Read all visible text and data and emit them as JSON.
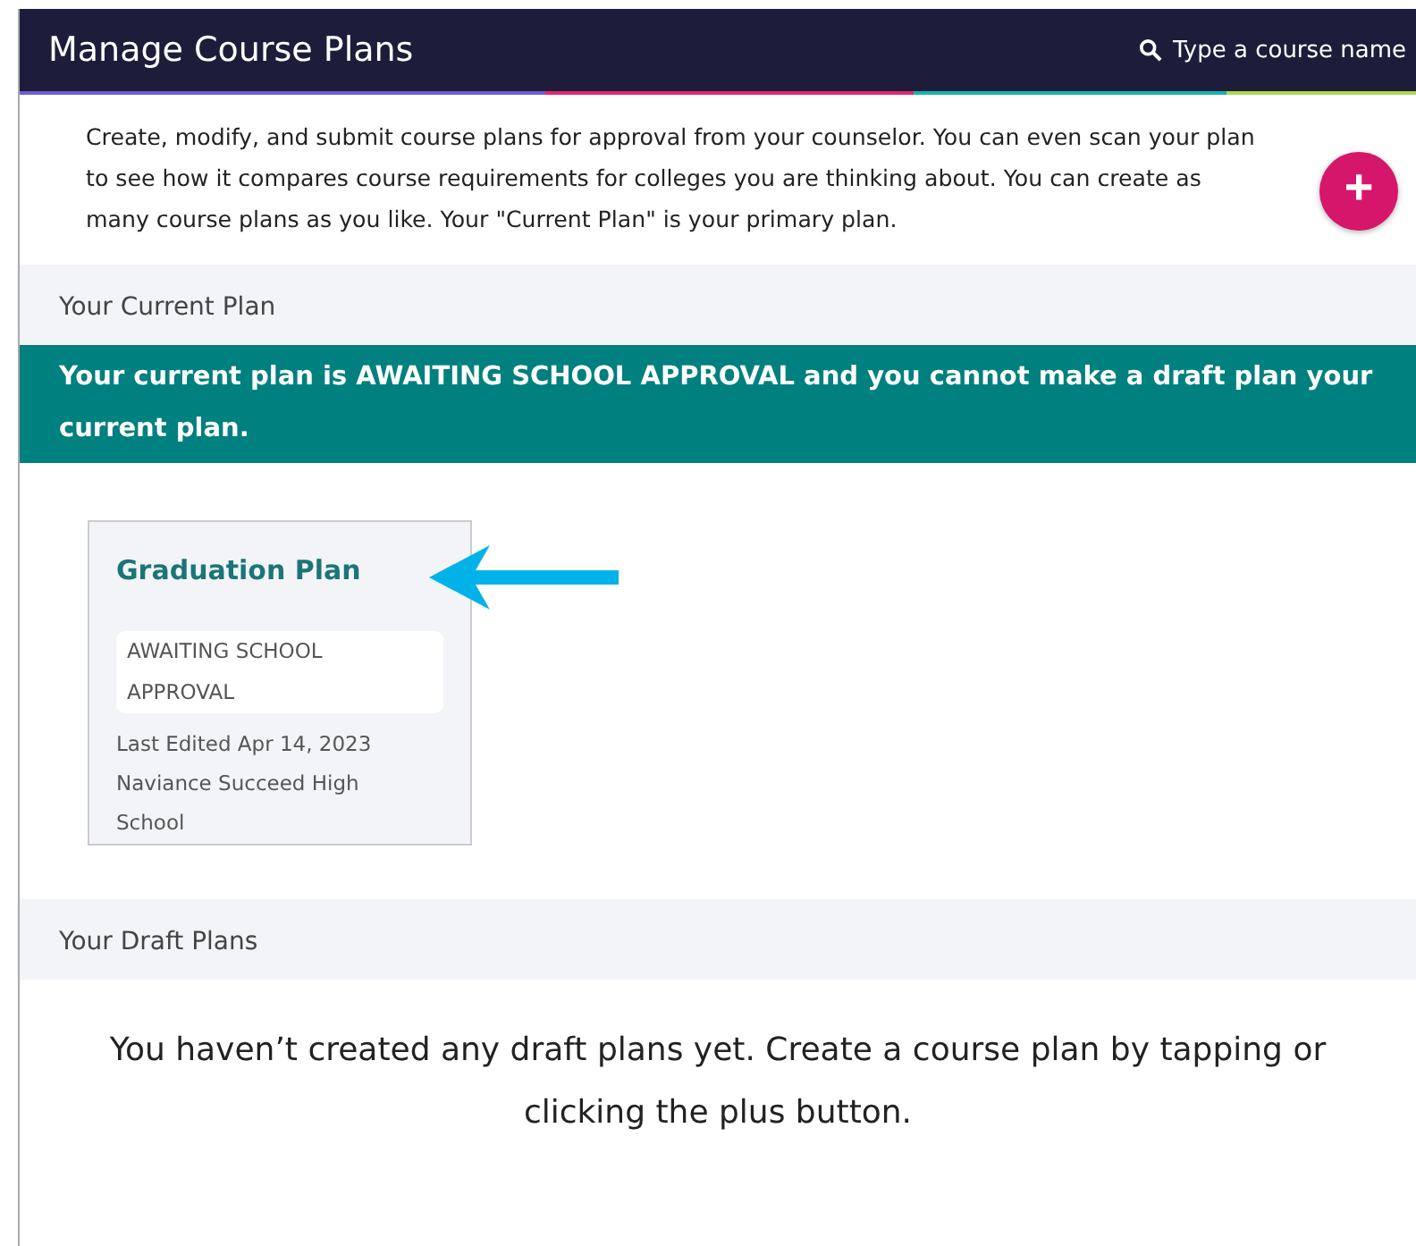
{
  "header": {
    "title": "Manage Course Plans",
    "search": {
      "placeholder": "Type a course name"
    }
  },
  "intro": "Create, modify, and submit course plans for approval from your counselor. You can even scan your plan to see how it compares course requirements for colleges you are thinking about. You can create as many course plans as you like. Your \"Current Plan\" is your primary plan.",
  "add_button": "+",
  "current_section": {
    "heading": "Your Current Plan",
    "banner": "Your current plan is AWAITING SCHOOL APPROVAL and you cannot make a draft plan your current plan.",
    "plans": [
      {
        "title": "Graduation Plan",
        "status": "AWAITING SCHOOL APPROVAL",
        "edited": "Last Edited Apr 14, 2023",
        "school": "Naviance Succeed High School",
        "highlighted": true
      }
    ]
  },
  "draft_section": {
    "heading": "Your Draft Plans",
    "empty_message": "You haven’t created any draft plans yet. Create a course plan by tapping or clicking the plus button."
  }
}
